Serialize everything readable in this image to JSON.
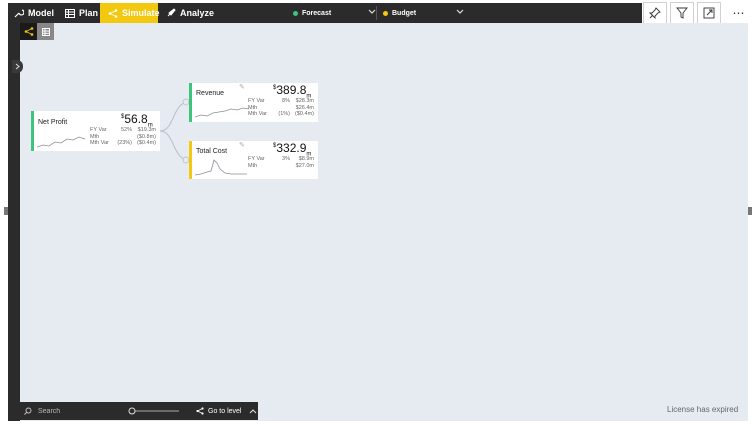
{
  "toolbar": {
    "model": "Model",
    "plan": "Plan",
    "simulate": "Simulate",
    "analyze": "Analyze",
    "forecast": {
      "label": "Forecast",
      "color": "#3cc47c"
    },
    "budget": {
      "label": "Budget",
      "color": "#f2c811"
    }
  },
  "colors": {
    "accent": "#f2c811",
    "positive": "#3cc47c",
    "dark": "#2b2b2b"
  },
  "icons": [
    "wrench-icon",
    "table-icon",
    "tree-icon",
    "rocket-icon",
    "pin-icon",
    "filter-icon",
    "focus-mode-icon",
    "more-icon"
  ],
  "nodes": {
    "net_profit": {
      "name": "Net Profit",
      "currency": "$",
      "value": "56.8",
      "unit": "m",
      "rows": [
        {
          "label": "FY Var",
          "pct": "52%",
          "val": "$19.3m"
        },
        {
          "label": "Mth",
          "pct": "",
          "val": "($0.8m)"
        },
        {
          "label": "Mth Var",
          "pct": "(23%)",
          "val": "($0.4m)"
        }
      ]
    },
    "revenue": {
      "name": "Revenue",
      "currency": "$",
      "value": "389.8",
      "unit": "m",
      "rows": [
        {
          "label": "FY Var",
          "pct": "8%",
          "val": "$28.3m"
        },
        {
          "label": "Mth",
          "pct": "",
          "val": "$26.4m"
        },
        {
          "label": "Mth Var",
          "pct": "(1%)",
          "val": "($0.4m)"
        }
      ]
    },
    "total_cost": {
      "name": "Total Cost",
      "currency": "$",
      "value": "332.9",
      "unit": "m",
      "rows": [
        {
          "label": "FY Var",
          "pct": "3%",
          "val": "$8.9m"
        },
        {
          "label": "Mth",
          "pct": "",
          "val": "$27.0m"
        }
      ]
    }
  },
  "bottom": {
    "search_placeholder": "Search",
    "goto_level": "Go to level"
  },
  "license": "License has expired"
}
